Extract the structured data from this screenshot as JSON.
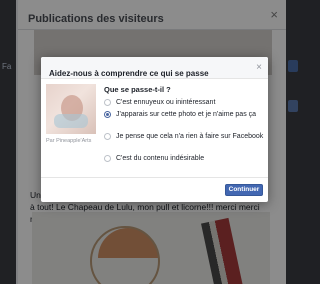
{
  "background": {
    "dialog_title": "Publications des visiteurs",
    "close_symbol": "×",
    "post_text_prefix": "Un",
    "post_text": "à tout! Le Chapeau de Lulu, mon pull et licorne!!! merci merci merci",
    "heart": "♥",
    "left_label": "Fa"
  },
  "modal": {
    "title": "Aidez-nous à comprendre ce qui se passe",
    "close_symbol": "×",
    "thumbnail_caption": "Par Pineapple'Arts",
    "question": "Que se passe-t-il ?",
    "options": [
      {
        "label": "C'est ennuyeux ou inintéressant",
        "selected": false
      },
      {
        "label": "J'apparais sur cette photo et je n'aime pas ça",
        "selected": true
      },
      {
        "label": "Je pense que cela n'a rien à faire sur Facebook",
        "selected": false
      },
      {
        "label": "C'est du contenu indésirable",
        "selected": false
      }
    ],
    "continue_label": "Continuer"
  },
  "colors": {
    "primary_button": "#4267b2",
    "header_bg": "#f6f7f9",
    "text": "#1d2129",
    "muted": "#90949c"
  }
}
